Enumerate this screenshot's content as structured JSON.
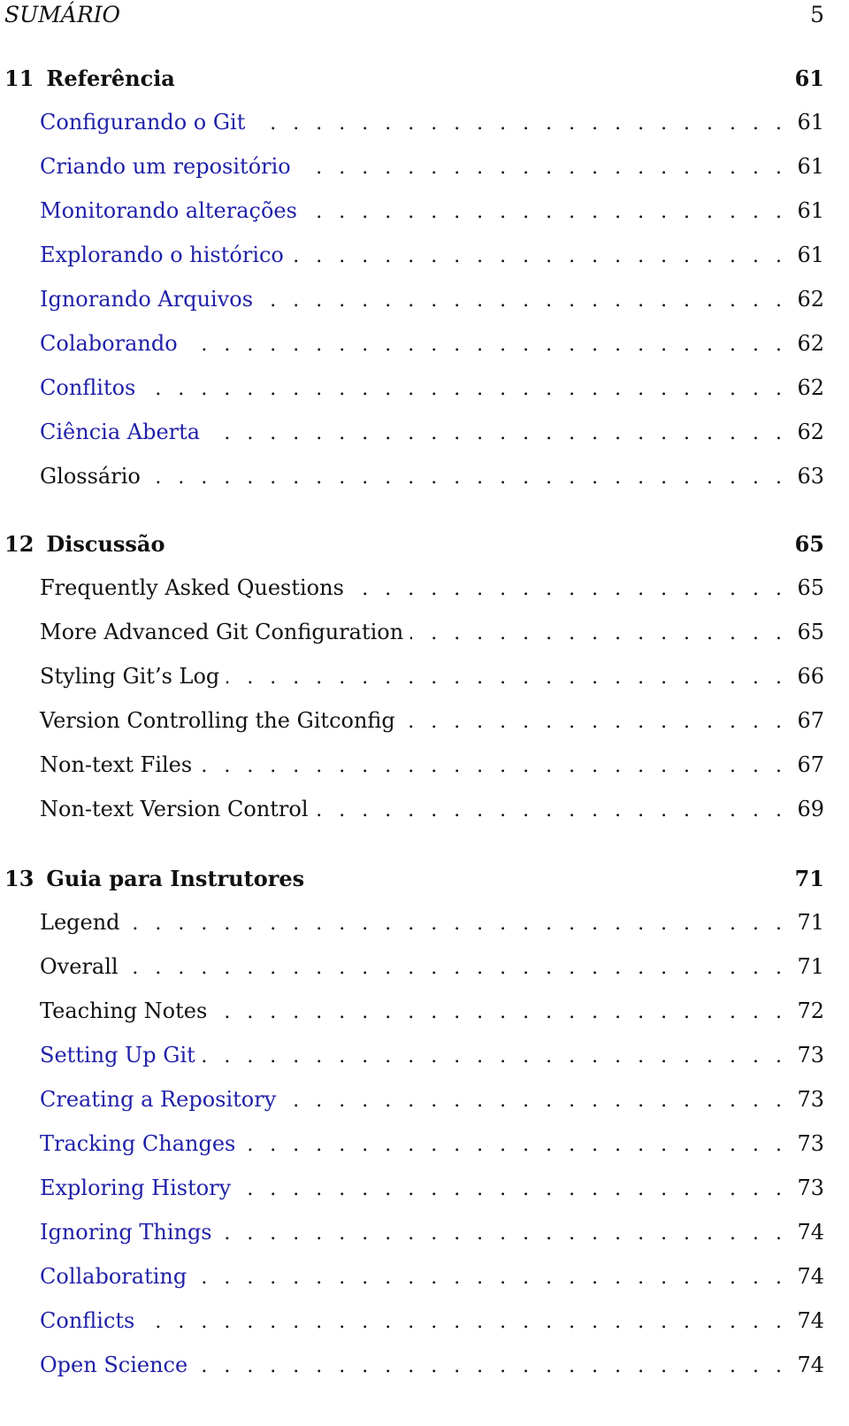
{
  "running_head": {
    "title": "SUMÁRIO",
    "page": "5"
  },
  "colors": {
    "link": "#1f1fa9",
    "text": "#111111"
  },
  "chapters": [
    {
      "number": "11",
      "title": "Referência",
      "page": "61",
      "entries": [
        {
          "label": "Configurando o Git",
          "page": "61",
          "link": true
        },
        {
          "label": "Criando um repositório",
          "page": "61",
          "link": true
        },
        {
          "label": "Monitorando alterações",
          "page": "61",
          "link": true
        },
        {
          "label": "Explorando o histórico",
          "page": "61",
          "link": true
        },
        {
          "label": "Ignorando Arquivos",
          "page": "62",
          "link": true
        },
        {
          "label": "Colaborando",
          "page": "62",
          "link": true
        },
        {
          "label": "Conflitos",
          "page": "62",
          "link": true
        },
        {
          "label": "Ciência Aberta",
          "page": "62",
          "link": true
        },
        {
          "label": "Glossário",
          "page": "63",
          "link": false
        }
      ]
    },
    {
      "number": "12",
      "title": "Discussão",
      "page": "65",
      "entries": [
        {
          "label": "Frequently Asked Questions",
          "page": "65",
          "link": false
        },
        {
          "label": "More Advanced Git Configuration",
          "page": "65",
          "link": false
        },
        {
          "label": "Styling Git’s Log",
          "page": "66",
          "link": false
        },
        {
          "label": "Version Controlling the Gitconfig",
          "page": "67",
          "link": false
        },
        {
          "label": "Non-text Files",
          "page": "67",
          "link": false
        },
        {
          "label": "Non-text Version Control",
          "page": "69",
          "link": false
        }
      ]
    },
    {
      "number": "13",
      "title": "Guia para Instrutores",
      "page": "71",
      "entries": [
        {
          "label": "Legend",
          "page": "71",
          "link": false
        },
        {
          "label": "Overall",
          "page": "71",
          "link": false
        },
        {
          "label": "Teaching Notes",
          "page": "72",
          "link": false
        },
        {
          "label": "Setting Up Git",
          "page": "73",
          "link": true
        },
        {
          "label": "Creating a Repository",
          "page": "73",
          "link": true
        },
        {
          "label": "Tracking Changes",
          "page": "73",
          "link": true
        },
        {
          "label": "Exploring History",
          "page": "73",
          "link": true
        },
        {
          "label": "Ignoring Things",
          "page": "74",
          "link": true
        },
        {
          "label": "Collaborating",
          "page": "74",
          "link": true
        },
        {
          "label": "Conflicts",
          "page": "74",
          "link": true
        },
        {
          "label": "Open Science",
          "page": "74",
          "link": true
        }
      ]
    }
  ]
}
